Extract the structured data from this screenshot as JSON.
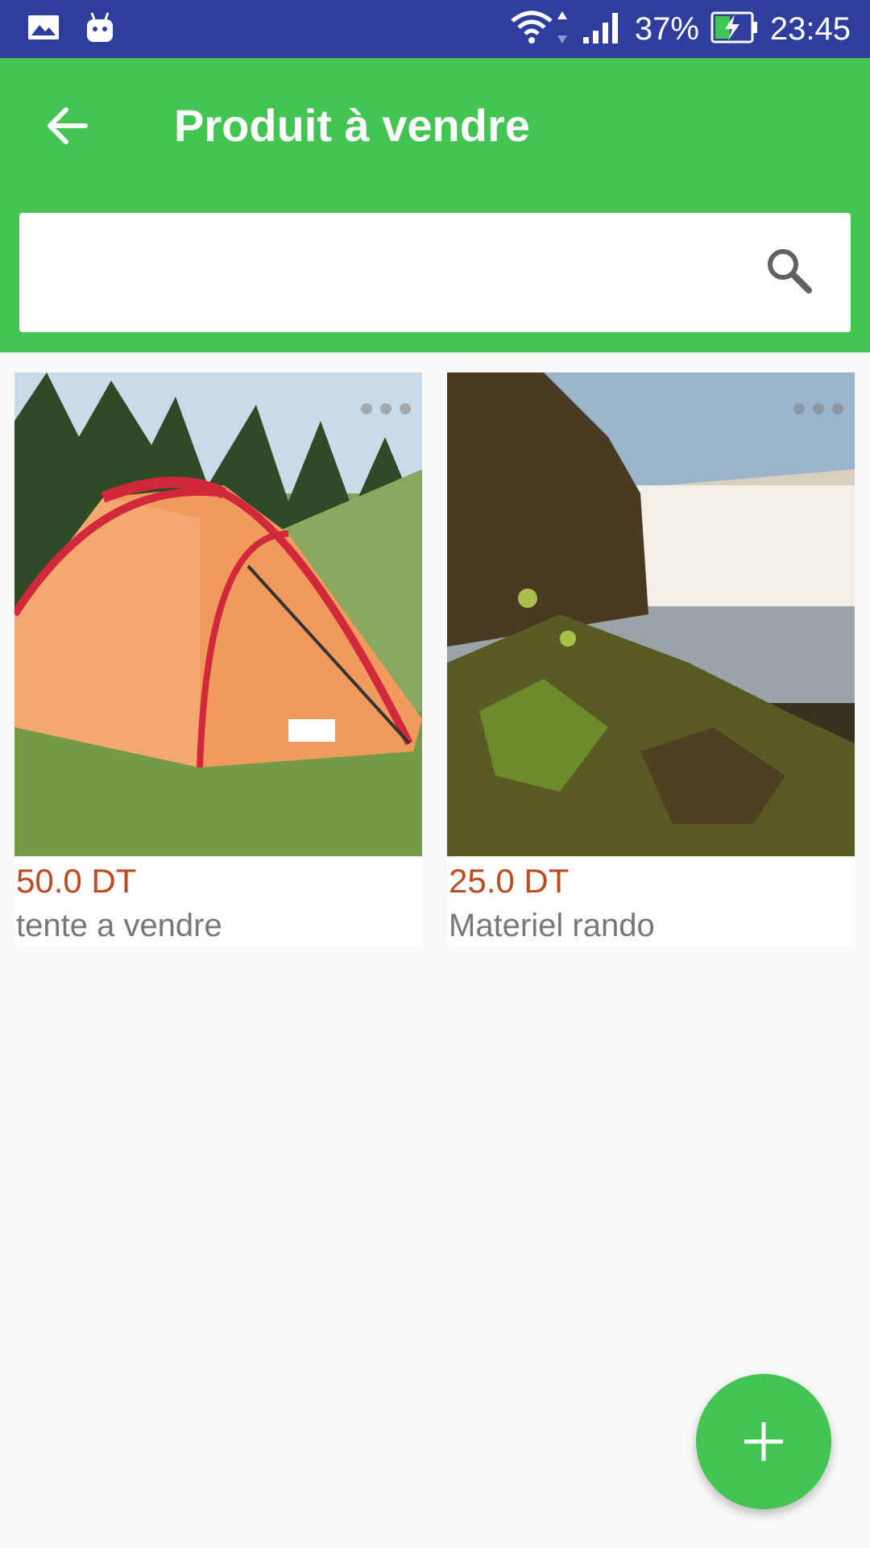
{
  "status_bar": {
    "icons": [
      "gallery-icon",
      "android-icon",
      "wifi-icon",
      "signal-icon",
      "battery-charging-icon"
    ],
    "battery": "37%",
    "time": "23:45"
  },
  "app_bar": {
    "title": "Produit à vendre",
    "back_icon": "arrow-back-icon",
    "color": "#42c553"
  },
  "search": {
    "value": "",
    "icon": "search-icon"
  },
  "products": [
    {
      "price": "50.0 DT",
      "name": "tente a vendre",
      "image": "tent"
    },
    {
      "price": "25.0 DT",
      "name": "Materiel rando",
      "image": "waterfall"
    }
  ],
  "fab": {
    "icon": "plus-icon",
    "color": "#42c553"
  },
  "colors": {
    "status_bar": "#2f3e9e",
    "price": "#c0491f",
    "text_secondary": "#777777"
  }
}
